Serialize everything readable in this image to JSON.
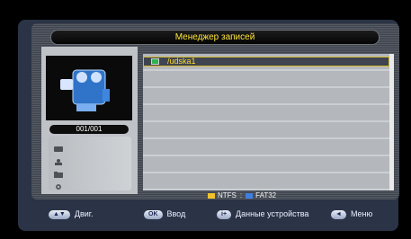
{
  "title": "Менеджер записей",
  "counter": "001/001",
  "list": {
    "items": [
      {
        "name": "/udska1",
        "selected": true
      }
    ]
  },
  "legend": {
    "ntfs_label": "NTFS",
    "fat32_label": "FAT32",
    "ntfs_color": "#f0c22c",
    "fat32_color": "#3f7fe0"
  },
  "footer": {
    "nav": {
      "key": "▲▼",
      "label": "Двиг."
    },
    "ok": {
      "key": "OK",
      "label": "Ввод"
    },
    "info": {
      "key": "i+",
      "label": "Данные устройства"
    },
    "menu": {
      "key": "◄",
      "label": "Меню"
    }
  },
  "side_icons": [
    "hdd-icon",
    "user-icon",
    "folder-icon",
    "settings-icon"
  ]
}
